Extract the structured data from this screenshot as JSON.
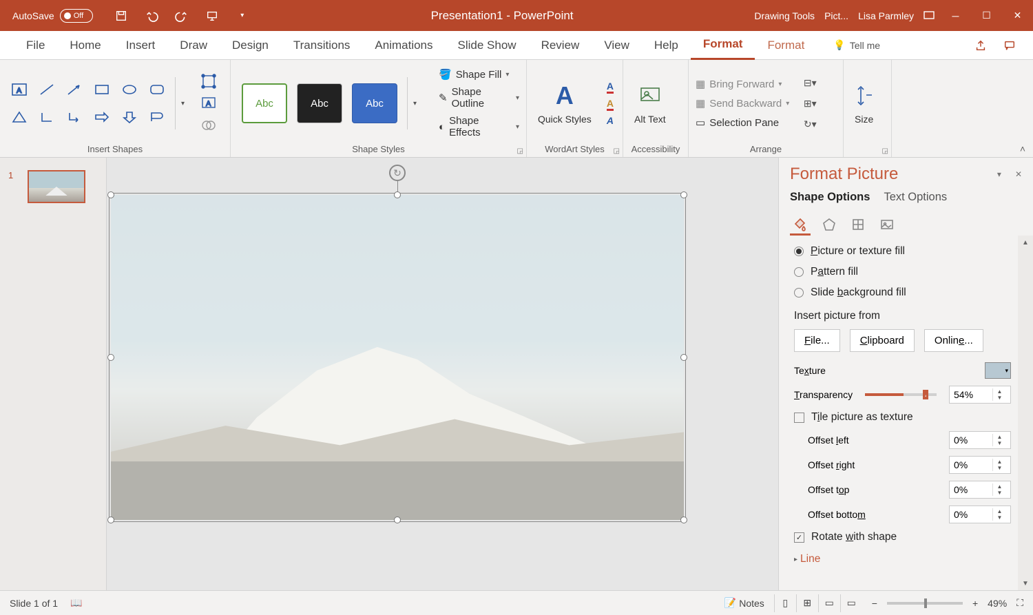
{
  "titlebar": {
    "autosave_label": "AutoSave",
    "autosave_off": "Off",
    "doc_title": "Presentation1 - PowerPoint",
    "drawing_tools": "Drawing Tools",
    "picture_tools": "Pict...",
    "user": "Lisa Parmley"
  },
  "tabs": {
    "file": "File",
    "home": "Home",
    "insert": "Insert",
    "draw": "Draw",
    "design": "Design",
    "transitions": "Transitions",
    "animations": "Animations",
    "slideshow": "Slide Show",
    "review": "Review",
    "view": "View",
    "help": "Help",
    "format1": "Format",
    "format2": "Format",
    "tellme": "Tell me"
  },
  "ribbon": {
    "insert_shapes": "Insert Shapes",
    "shape_styles": "Shape Styles",
    "abc": "Abc",
    "shape_fill": "Shape Fill",
    "shape_outline": "Shape Outline",
    "shape_effects": "Shape Effects",
    "wordart_styles": "WordArt Styles",
    "quick_styles": "Quick Styles",
    "accessibility": "Accessibility",
    "alt_text": "Alt Text",
    "arrange": "Arrange",
    "bring_forward": "Bring Forward",
    "send_backward": "Send Backward",
    "selection_pane": "Selection Pane",
    "size": "Size"
  },
  "thumb": {
    "num": "1"
  },
  "pane": {
    "title": "Format Picture",
    "shape_options": "Shape Options",
    "text_options": "Text Options",
    "picture_fill": "Picture or texture fill",
    "pattern_fill": "Pattern fill",
    "slide_bg": "Slide background fill",
    "insert_from": "Insert picture from",
    "file": "File...",
    "clipboard": "Clipboard",
    "online": "Online...",
    "texture": "Texture",
    "transparency": "Transparency",
    "transparency_value": "54%",
    "transparency_pct": 54,
    "tile": "Tile picture as texture",
    "offset_left": "Offset left",
    "offset_right": "Offset right",
    "offset_top": "Offset top",
    "offset_bottom": "Offset bottom",
    "offset_left_v": "0%",
    "offset_right_v": "0%",
    "offset_top_v": "0%",
    "offset_bottom_v": "0%",
    "rotate": "Rotate with shape",
    "line": "Line"
  },
  "status": {
    "slide": "Slide 1 of 1",
    "notes": "Notes",
    "zoom": "49%"
  }
}
